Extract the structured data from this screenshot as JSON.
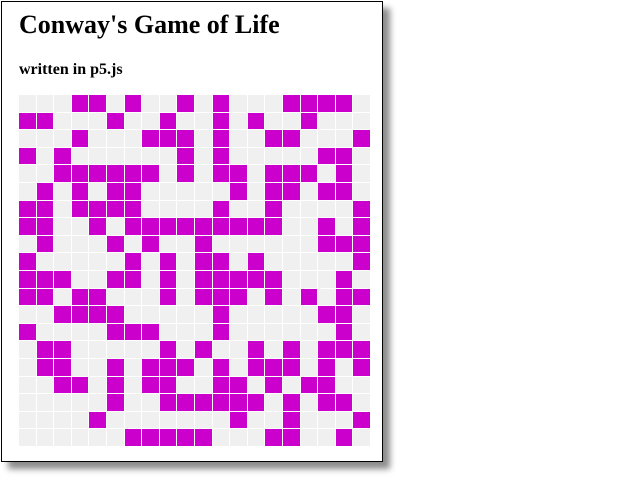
{
  "page": {
    "title": "Conway's Game of Life",
    "subtitle": "written in p5.js"
  },
  "colors": {
    "alive": "#cc00cc",
    "dead": "#f0f0f0",
    "background": "#ffffff",
    "border": "#000000"
  },
  "grid": {
    "rows": 20,
    "cols": 20,
    "cells": [
      "00011010010100011110",
      "11000100100101001000",
      "00010001110100110001",
      "10100000010100000110",
      "00111111010110111010",
      "01010110000010110110",
      "11011110000100100001",
      "11001011111111100101",
      "01000101001000000111",
      "10000010101101000001",
      "11100110101111100010",
      "11011000101110101011",
      "00111100000100000110",
      "10000111000100000010",
      "01100000101001010111",
      "01100101110101110101",
      "00110101100110101100",
      "00000100111111010110",
      "00001000000010010001",
      "00000011111000110010"
    ]
  }
}
